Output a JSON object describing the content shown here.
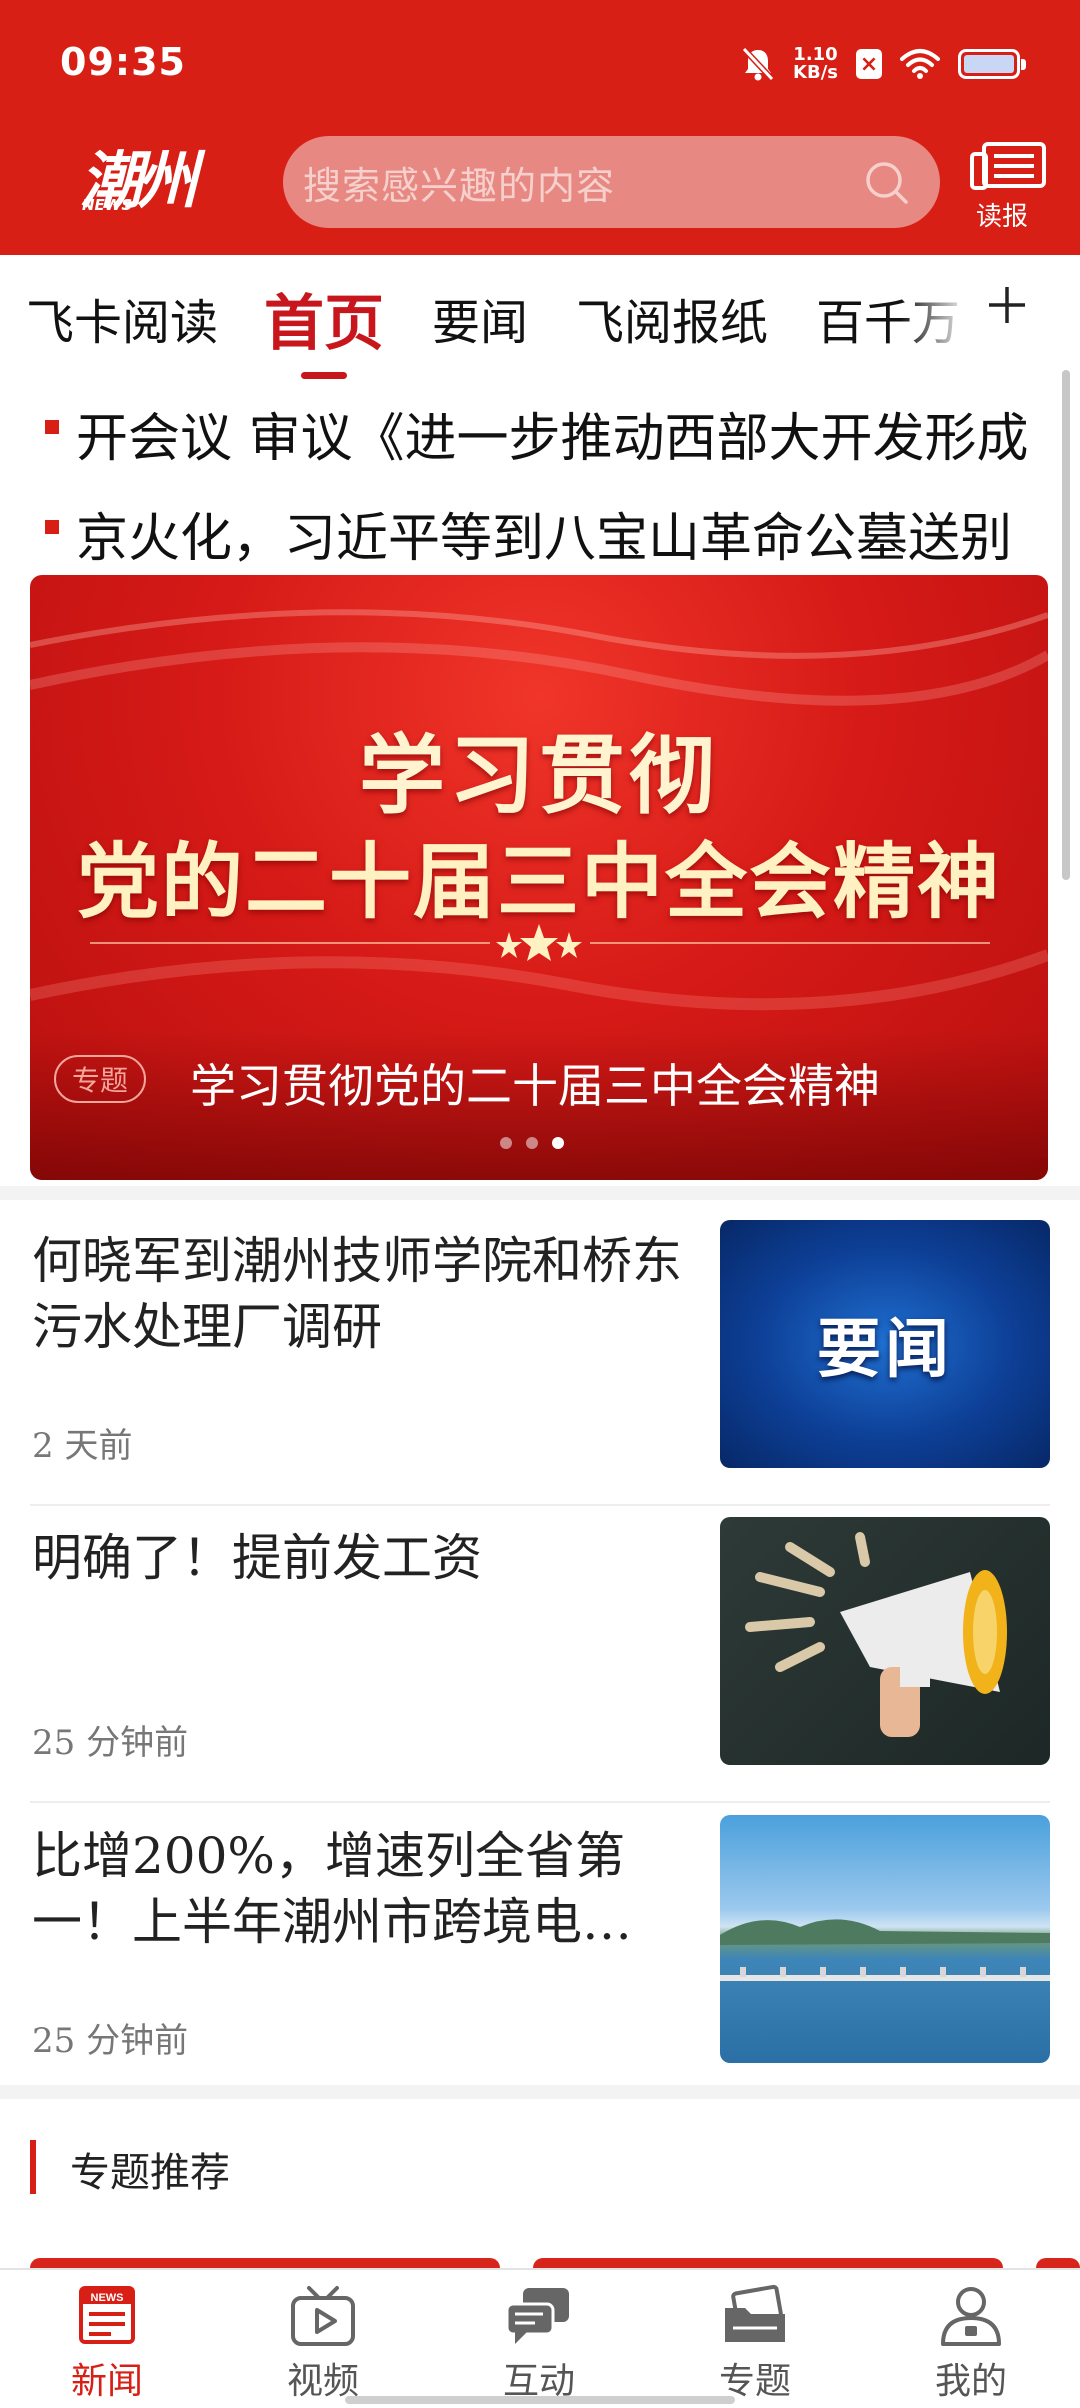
{
  "status_bar": {
    "time": "09:35",
    "net_speed_value": "1.10",
    "net_speed_unit": "KB/s",
    "icons": [
      "bell-muted-icon",
      "x-box-icon",
      "wifi-icon",
      "battery-icon"
    ]
  },
  "header": {
    "logo_text": "潮州",
    "logo_subtext": "NEWS",
    "search_placeholder": "搜索感兴趣的内容",
    "read_paper_label": "读报",
    "color_brand": "#d71f15"
  },
  "tabs": [
    {
      "label": "飞卡阅读",
      "active": false
    },
    {
      "label": "首页",
      "active": true
    },
    {
      "label": "要闻",
      "active": false
    },
    {
      "label": "飞阅报纸",
      "active": false
    },
    {
      "label": "百千万",
      "active": false
    }
  ],
  "ticker": [
    "开会议  审议《进一步推动西部大开发形成",
    "京火化，习近平等到八宝山革命公墓送别"
  ],
  "banner": {
    "headline_line1": "学习贯彻",
    "headline_line2": "党的二十届三中全会精神",
    "tag": "专题",
    "caption": "学习贯彻党的二十届三中全会精神",
    "slide_count": 3,
    "active_slide": 3
  },
  "news": [
    {
      "title": "何晓军到潮州技师学院和桥东污水处理厂调研",
      "time": "2 天前",
      "thumb_text": "要闻",
      "thumb": "blue-news-graphic"
    },
    {
      "title": "明确了！提前发工资",
      "time": "25 分钟前",
      "thumb_text": "",
      "thumb": "megaphone-photo"
    },
    {
      "title": "比增200%，增速列全省第一！上半年潮州市跨境电…",
      "time": "25 分钟前",
      "thumb_text": "",
      "thumb": "lake-bridge-photo"
    }
  ],
  "topics": {
    "title": "专题推荐"
  },
  "bottom_nav": [
    {
      "label": "新闻",
      "icon": "news-icon",
      "active": true
    },
    {
      "label": "视频",
      "icon": "video-icon",
      "active": false
    },
    {
      "label": "互动",
      "icon": "chat-icon",
      "active": false
    },
    {
      "label": "专题",
      "icon": "folder-icon",
      "active": false
    },
    {
      "label": "我的",
      "icon": "profile-icon",
      "active": false
    }
  ]
}
